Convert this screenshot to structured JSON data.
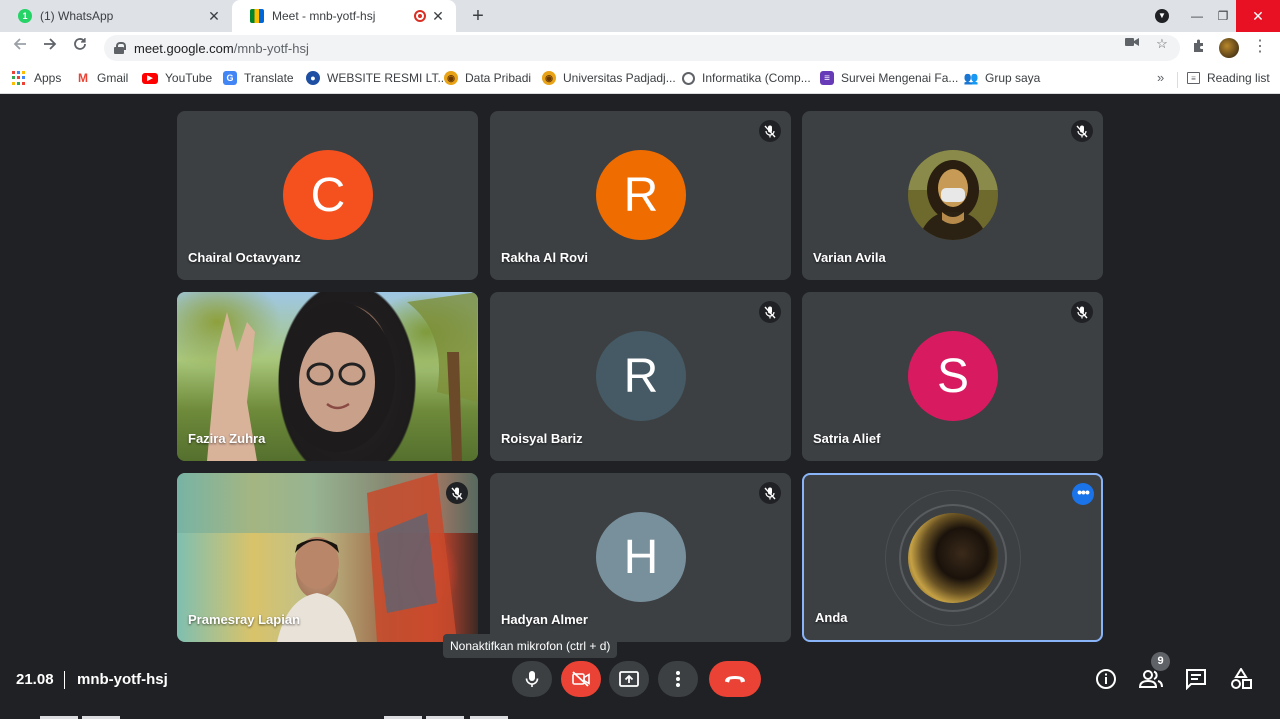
{
  "browser": {
    "tabs": [
      {
        "label": "(1) WhatsApp",
        "badge": "1"
      },
      {
        "label": "Meet - mnb-yotf-hsj"
      }
    ],
    "new_tab": "+",
    "window": {
      "minimize": "—",
      "restore": "❐",
      "close": "✕"
    },
    "url_host": "meet.google.com",
    "url_path": "/mnb-yotf-hsj",
    "bookmarks": [
      "Apps",
      "Gmail",
      "YouTube",
      "Translate",
      "WEBSITE RESMI LT...",
      "Data Pribadi",
      "Universitas Padjadj...",
      "Informatika (Comp...",
      "Survei Mengenai Fa...",
      "Grup saya"
    ],
    "bookmarks_more": "»",
    "reading_list": "Reading list"
  },
  "participants": [
    {
      "name": "Chairal Octavyanz",
      "initial": "C",
      "color": "#f4511e",
      "muted": false
    },
    {
      "name": "Rakha Al Rovi",
      "initial": "R",
      "color": "#ef6c00",
      "muted": true
    },
    {
      "name": "Varian Avila",
      "initial": "",
      "muted": true
    },
    {
      "name": "Fazira Zuhra",
      "muted": false
    },
    {
      "name": "Roisyal Bariz",
      "initial": "R",
      "color": "#455a64",
      "muted": true
    },
    {
      "name": "Satria Alief",
      "initial": "S",
      "color": "#d81b60",
      "muted": true
    },
    {
      "name": "Pramesray Lapian",
      "muted": true
    },
    {
      "name": "Hadyan Almer",
      "initial": "H",
      "color": "#78909c",
      "muted": true
    },
    {
      "name": "Anda",
      "muted": false
    }
  ],
  "meeting": {
    "time": "21.08",
    "code": "mnb-yotf-hsj",
    "tooltip": "Nonaktifkan mikrofon (ctrl + d)",
    "participant_count": "9"
  },
  "colors": {
    "background": "#202124",
    "tile": "#3c4043",
    "danger": "#ea4335",
    "accent": "#1a73e8",
    "speaking_border": "#8ab4f8"
  }
}
